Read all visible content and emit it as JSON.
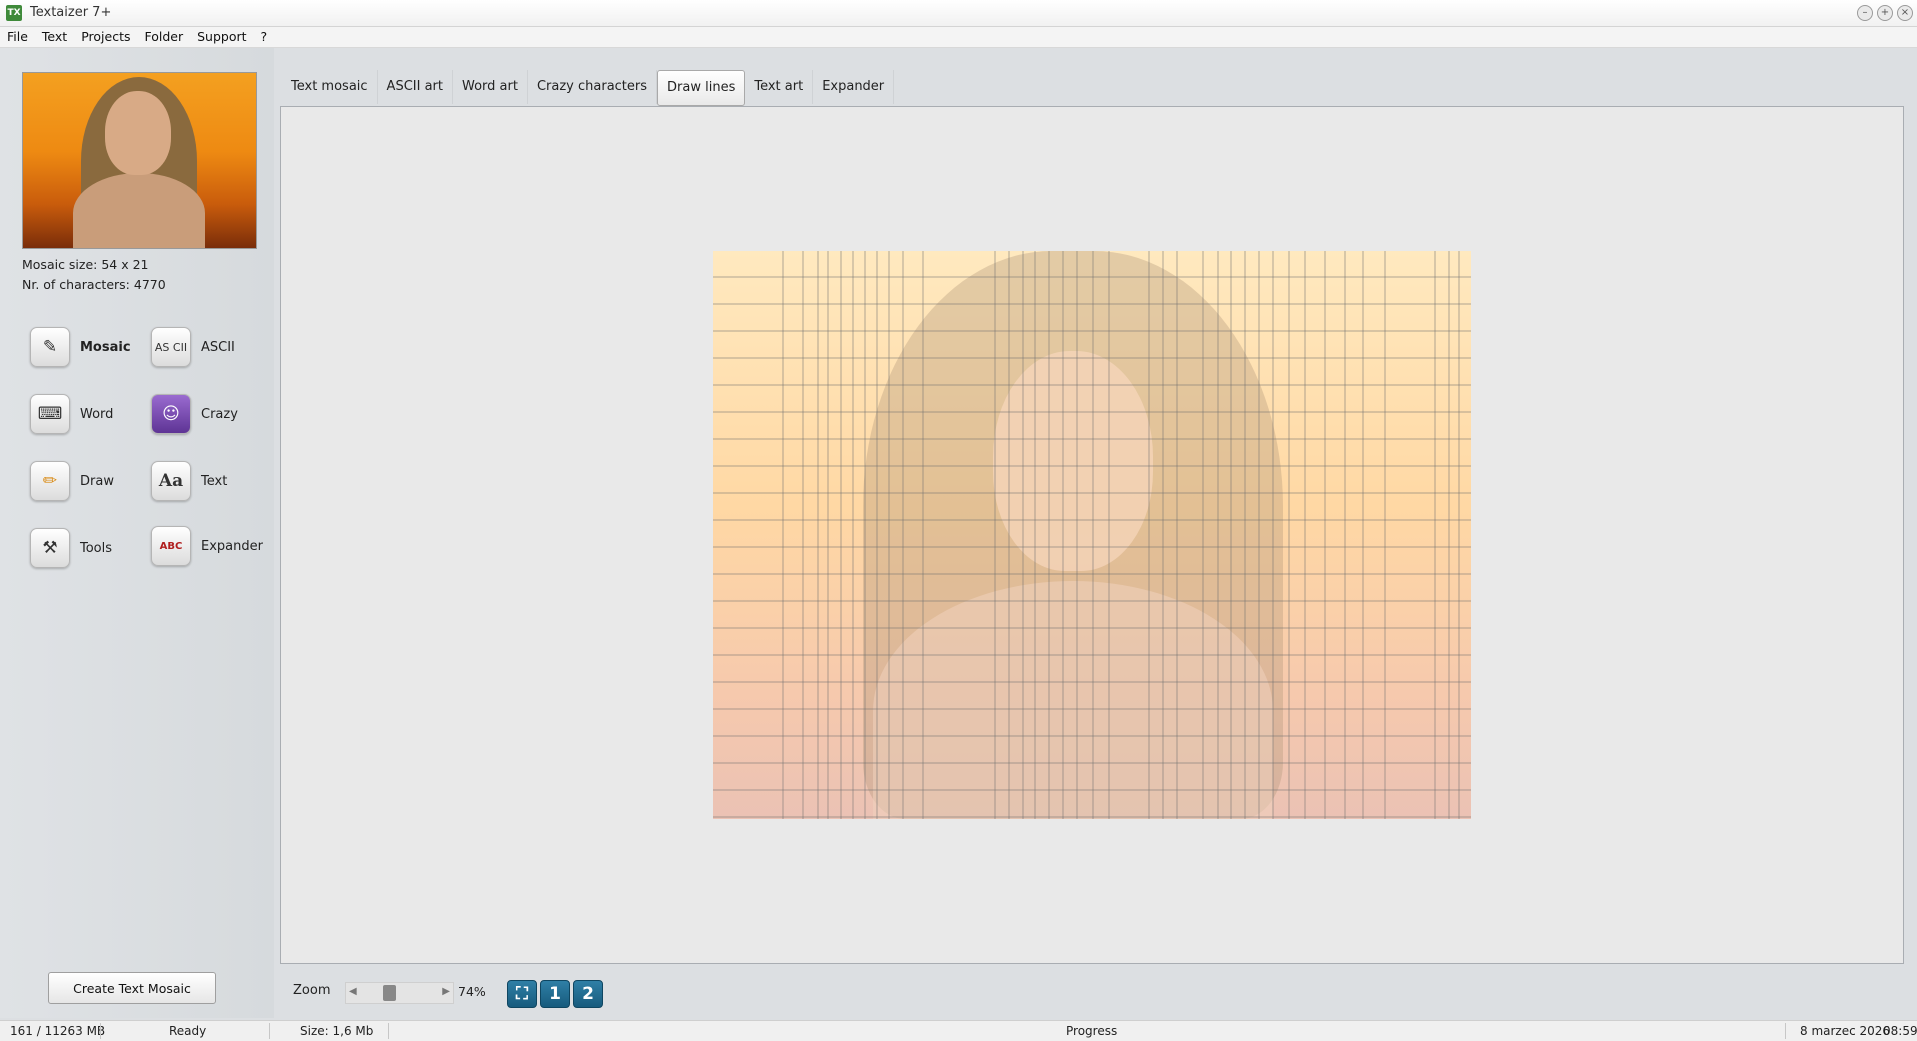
{
  "window": {
    "title": "Textaizer 7+",
    "app_icon": "TX"
  },
  "menu": [
    "File",
    "Text",
    "Projects",
    "Folder",
    "Support",
    "?"
  ],
  "sidebar": {
    "mosaic_size": "Mosaic size: 54 x 21",
    "nr_characters": "Nr. of characters: 4770",
    "modes": [
      {
        "label": "Mosaic",
        "icon": "pen-paper-icon",
        "glyph": "✎"
      },
      {
        "label": "ASCII",
        "icon": "ascii-icon",
        "glyph": "AS CII"
      },
      {
        "label": "Word",
        "icon": "typewriter-icon",
        "glyph": "⌨"
      },
      {
        "label": "Crazy",
        "icon": "crazy-face-icon",
        "glyph": "☺"
      },
      {
        "label": "Draw",
        "icon": "pencil-icon",
        "glyph": "✏"
      },
      {
        "label": "Text",
        "icon": "font-icon",
        "glyph": "Aa"
      },
      {
        "label": "Tools",
        "icon": "tools-icon",
        "glyph": "⚒"
      },
      {
        "label": "Expander",
        "icon": "abc-brush-icon",
        "glyph": "ABC"
      }
    ],
    "create_button": "Create Text Mosaic"
  },
  "tabs": [
    "Text mosaic",
    "ASCII art",
    "Word art",
    "Crazy characters",
    "Draw lines",
    "Text art",
    "Expander"
  ],
  "active_tab": "Draw lines",
  "zoom": {
    "label": "Zoom",
    "value": "74%",
    "buttons": [
      "1",
      "2"
    ]
  },
  "status": {
    "memory": "161 / 11263 MB",
    "state": "Ready",
    "size": "Size: 1,6 Mb",
    "progress": "Progress",
    "date": "8 marzec 2026",
    "time": "08:59"
  },
  "colors": {
    "zoom_buttons": "#1d6a8f",
    "art_top": "#ffe9bf",
    "art_bottom": "#ebc2b4"
  }
}
